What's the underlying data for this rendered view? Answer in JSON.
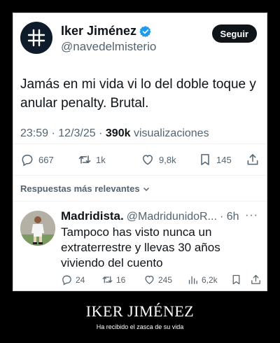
{
  "tweet": {
    "author_name": "Iker Jiménez",
    "handle": "@navedelmisterio",
    "follow_label": "Seguir",
    "text": "Jamás en mi vida vi lo del doble toque y anular penalty. Brutal.",
    "time": "23:59",
    "date": "12/3/25",
    "views_count": "390k",
    "views_label": "visualizaciones",
    "separator": "·",
    "stats": {
      "replies": "667",
      "retweets": "1k",
      "likes": "9,8k",
      "bookmarks": "145"
    },
    "icons": {
      "avatar": "hash-grid-icon",
      "verified": "verified-badge-icon",
      "reply": "comment-icon",
      "retweet": "retweet-icon",
      "like": "heart-icon",
      "bookmark": "bookmark-icon",
      "share": "share-icon"
    }
  },
  "replies_section": {
    "label": "Respuestas más relevantes"
  },
  "reply": {
    "author_name": "Madridista.",
    "handle": "@MadridunidoR...",
    "time": "· 6h",
    "more": "···",
    "text": "Tampoco has visto nunca un extraterrestre y llevas 30 años viviendo del cuento",
    "stats": {
      "replies": "24",
      "retweets": "16",
      "likes": "245",
      "views": "6,2k"
    }
  },
  "poster": {
    "title": "IKER JIMÉNEZ",
    "subtitle": "Ha recibido el zasca de su vida"
  },
  "colors": {
    "accent_blue": "#1d9bf0",
    "text_primary": "#0f1419",
    "text_secondary": "#536471",
    "poster_title": "#ffffff",
    "background": "#000000"
  }
}
